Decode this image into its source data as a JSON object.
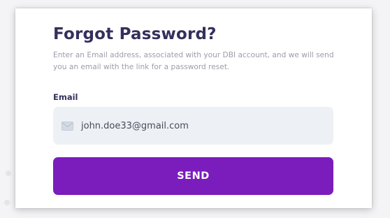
{
  "form": {
    "title": "Forgot Password?",
    "description": "Enter an Email address, associated with your DBI account, and we will send you an email with the link for a password reset.",
    "email_label": "Email",
    "email_value": "john.doe33@gmail.com",
    "email_icon": "mail-icon",
    "send_label": "SEND"
  },
  "colors": {
    "title": "#33305c",
    "description": "#9c9caa",
    "input_background": "#edf1f6",
    "button": "#7a1dbc",
    "button_text": "#ffffff"
  }
}
